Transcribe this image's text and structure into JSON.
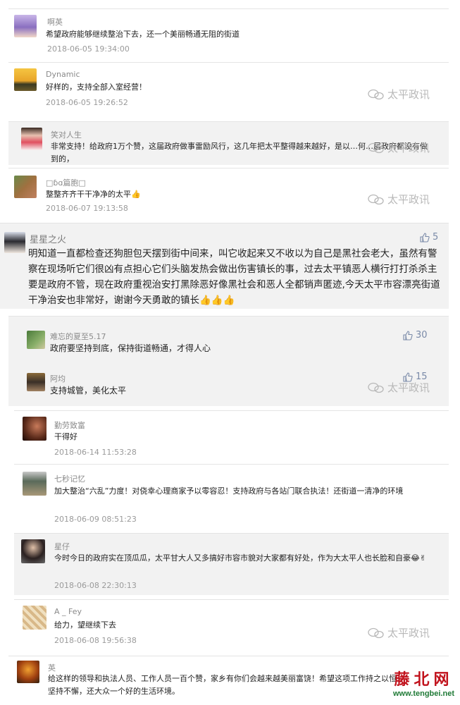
{
  "comments": [
    {
      "name": "啊英",
      "text": "希望政府能够继续整治下去，还一个美丽畅通无阻的街道",
      "time": "2018-06-05 19:34:00"
    },
    {
      "name": "Dynamic",
      "text": "好样的，支持全部入室经营！",
      "time": "2018-06-05 19:26:52"
    },
    {
      "name": "笑对人生",
      "text": "非常支持！给政府1万个赞，这届政府做事雷励风行，这几年把太平整得越来越好，是以…何…届政府都没有做到的，"
    },
    {
      "name": "□ɓɑ篇胞□",
      "text": "整整齐齐干干净净的太平👍",
      "time": "2018-06-07 19:13:58"
    },
    {
      "name": "星星之火",
      "likes": "5",
      "text": "明知道一直都检查还狗胆包天摆到街中间来，叫它收起来又不收以为自己是黑社会老大，虽然有警察在现场听它们很凶有点担心它们头脑发热会做出伤害镇长的事，过去太平镇恶人横行打打杀杀主要是政府不管，现在政府重视治安打黑除恶好像黑社会和恶人全都销声匿迹,今天太平市容漂亮街道干净治安也非常好，谢谢今天勇敢的镇长👍👍👍"
    },
    {
      "name": "难忘的夏至5.17",
      "likes": "30",
      "text": "政府要坚持到底，保持街道畅通，才得人心"
    },
    {
      "name": "阿均",
      "likes": "15",
      "text": "支持城管，美化太平"
    },
    {
      "name": "勤劳致富",
      "text": "干得好",
      "time": "2018-06-14 11:53:28"
    },
    {
      "name": "七秒记忆",
      "text": "加大整治“六乱”力度！对侥幸心理商家予以零容忍！支持政府与各站门联合执法！还街道一清净的环境",
      "time": "2018-06-09 08:51:23"
    },
    {
      "name": "星仔",
      "text": "今时今日的政府实在顶瓜瓜，太平甘大人又多搞好市容市貌对大家都有好处，作为大太平人也长脸和自豪😂✌",
      "time": "2018-06-08 22:30:13"
    },
    {
      "name": "A _ Fey",
      "text": "给力，望继续下去",
      "time": "2018-06-08 19:56:38"
    },
    {
      "name": "英",
      "text": "给这样的领导和执法人员、工作人员一百个赞，家乡有你们会越来越美丽富饶！希望这项工作持之以恒坚持不懈，还大众一个好的生活环境。"
    }
  ],
  "watermark": "太平政讯",
  "site_logo": {
    "name": "藤北网",
    "url": "www.tengbei.net"
  },
  "colors": {
    "gray_bg": "#f2f2f2",
    "logo_red": "#c1121c",
    "logo_green": "#1f7a36",
    "like_blue": "#7a8aa8"
  }
}
